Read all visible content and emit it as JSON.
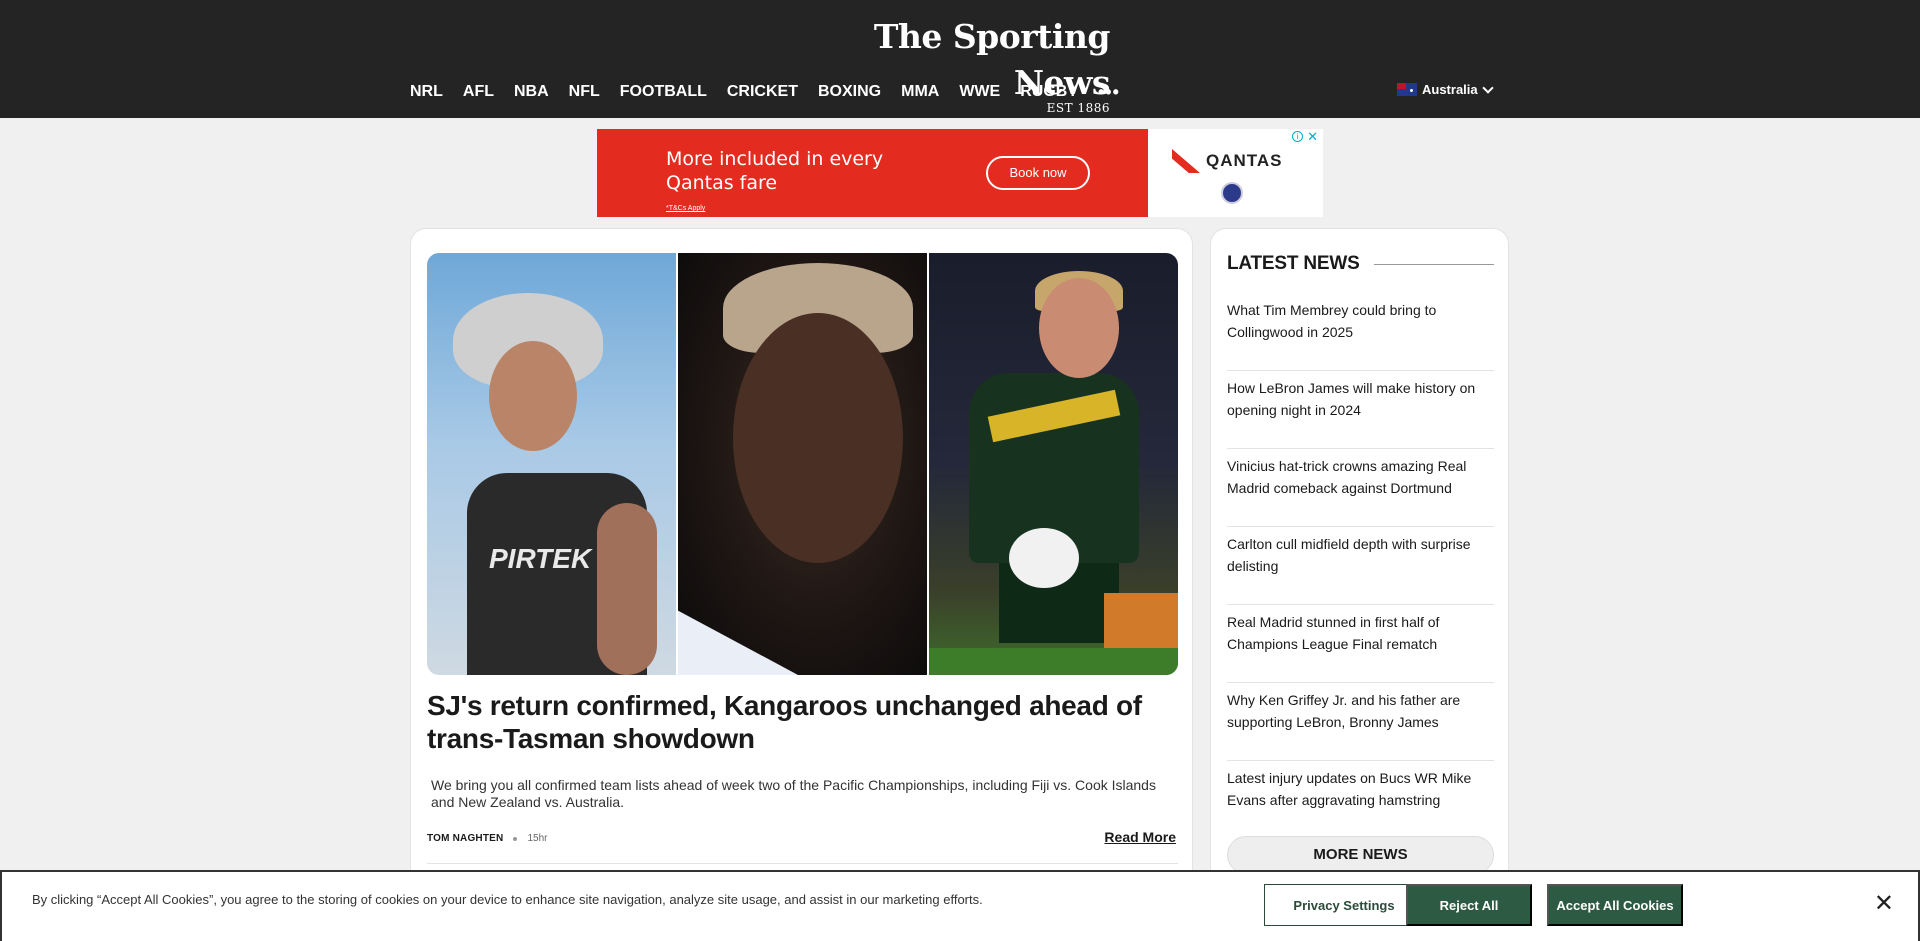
{
  "header": {
    "logo_name": "The Sporting News",
    "logo_est": "EST 1886",
    "nav": [
      "NRL",
      "AFL",
      "NBA",
      "NFL",
      "FOOTBALL",
      "CRICKET",
      "BOXING",
      "MMA",
      "WWE",
      "RUGBY"
    ],
    "more_label": "•••",
    "region": "Australia"
  },
  "ad": {
    "headline": "More included in every Qantas fare",
    "terms": "*T&Cs Apply",
    "cta": "Book now",
    "brand": "QANTAS",
    "choice_icon": "i",
    "close_icon": "✕"
  },
  "article": {
    "headline": "SJ's return confirmed, Kangaroos unchanged ahead of trans-Tasman showdown",
    "summary": "We bring you all confirmed team lists ahead of week two of the Pacific Championships, including Fiji vs. Cook Islands and New Zealand vs. Australia.",
    "author": "TOM NAGHTEN",
    "time": "15hr",
    "read_more": "Read More",
    "hero_sponsor": "PIRTEK"
  },
  "sidebar": {
    "title": "LATEST NEWS",
    "items": [
      "What Tim Membrey could bring to Collingwood in 2025",
      "How LeBron James will make history on opening night in 2024",
      "Vinicius hat-trick crowns amazing Real Madrid comeback against Dortmund",
      "Carlton cull midfield depth with surprise delisting",
      "Real Madrid stunned in first half of Champions League Final rematch",
      "Why Ken Griffey Jr. and his father are supporting LeBron, Bronny James",
      "Latest injury updates on Bucs WR Mike Evans after aggravating hamstring"
    ],
    "more": "MORE NEWS"
  },
  "cookie": {
    "text": "By clicking “Accept All Cookies”, you agree to the storing of cookies on your device to enhance site navigation, analyze site usage, and assist in our marketing efforts.",
    "privacy": "Privacy Settings",
    "reject": "Reject All",
    "accept": "Accept All Cookies",
    "close_icon": "✕"
  },
  "colors": {
    "header_bg": "#242424",
    "ad_red": "#e32b1f",
    "cookie_green": "#2d5a42"
  }
}
